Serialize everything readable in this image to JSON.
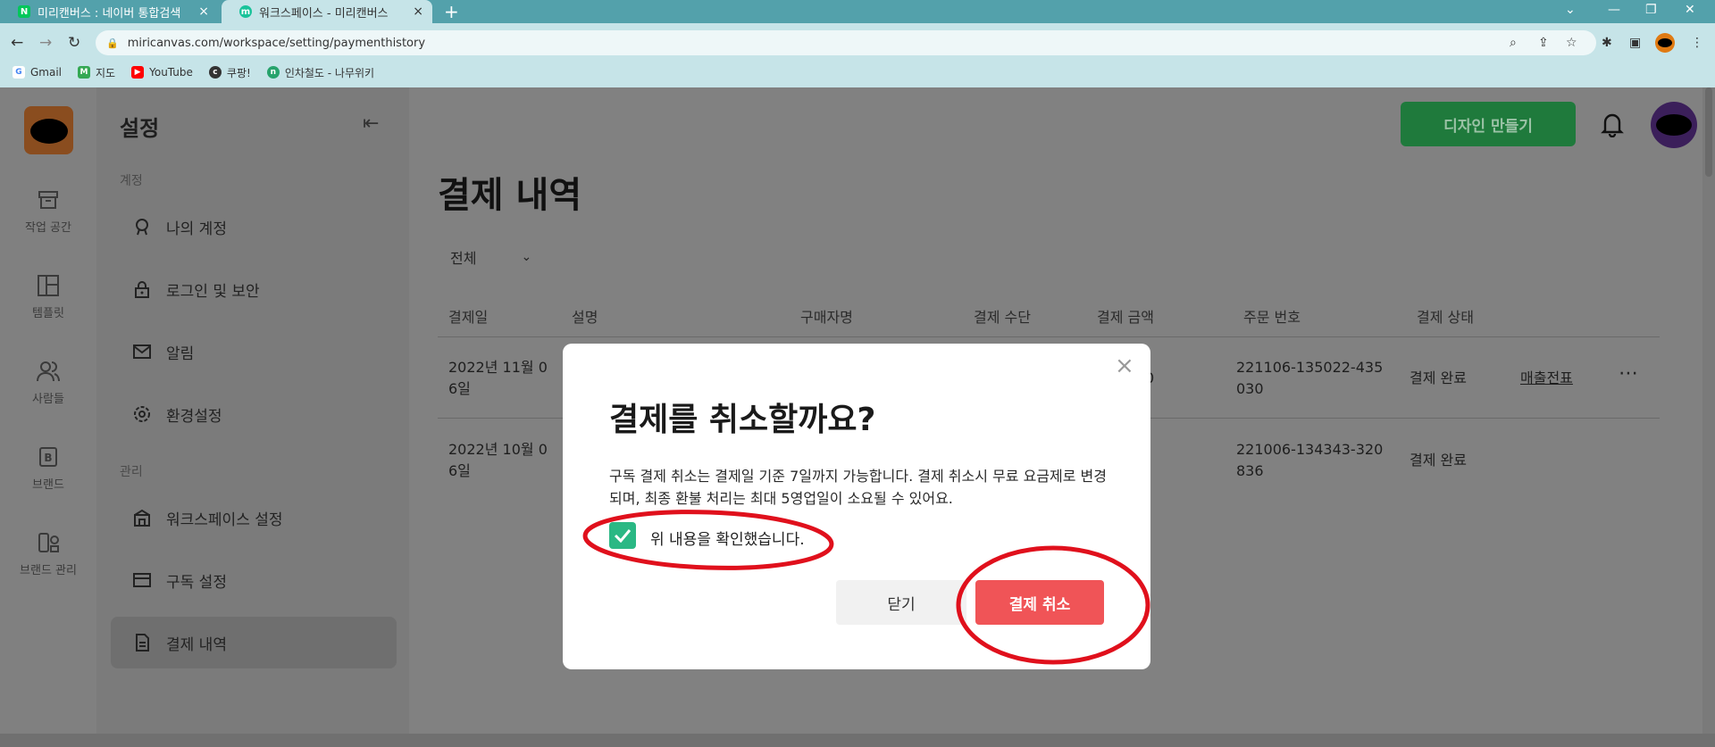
{
  "browser": {
    "tabs": [
      {
        "label": "미리캔버스 : 네이버 통합검색",
        "favicon": "N",
        "close": "×"
      },
      {
        "label": "워크스페이스 - 미리캔버스",
        "favicon": "m",
        "close": "×"
      }
    ],
    "new_tab": "+",
    "url": "miricanvas.com/workspace/setting/paymenthistory",
    "bookmarks": [
      {
        "label": "Gmail",
        "icon": "G"
      },
      {
        "label": "지도",
        "icon": "M"
      },
      {
        "label": "YouTube",
        "icon": "▶"
      },
      {
        "label": "쿠팡!",
        "icon": "c"
      },
      {
        "label": "인차철도 - 나무위키",
        "icon": "n"
      }
    ]
  },
  "app": {
    "rail": [
      {
        "label": "작업 공간",
        "icon": "archive-icon"
      },
      {
        "label": "템플릿",
        "icon": "layout-icon"
      },
      {
        "label": "사람들",
        "icon": "people-icon"
      },
      {
        "label": "브랜드",
        "icon": "brand-icon"
      },
      {
        "label": "브랜드 관리",
        "icon": "brand-manage-icon"
      }
    ],
    "sidebar": {
      "title": "설정",
      "section_account": "계정",
      "section_manage": "관리",
      "items": [
        {
          "label": "나의 계정",
          "icon": "account-icon"
        },
        {
          "label": "로그인 및 보안",
          "icon": "lock-icon"
        },
        {
          "label": "알림",
          "icon": "mail-icon"
        },
        {
          "label": "환경설정",
          "icon": "gear-icon"
        },
        {
          "label": "워크스페이스 설정",
          "icon": "building-icon"
        },
        {
          "label": "구독 설정",
          "icon": "card-icon"
        },
        {
          "label": "결제 내역",
          "icon": "document-icon"
        }
      ]
    },
    "header": {
      "create_button": "디자인 만들기"
    },
    "page_title": "결제 내역",
    "filter": "전체",
    "table": {
      "headers": [
        "결제일",
        "설명",
        "구매자명",
        "결제 수단",
        "결제 금액",
        "주문 번호",
        "결제 상태"
      ],
      "rows": [
        {
          "date_line1": "2022년 11월 0",
          "date_line2": "6일",
          "amount_fragment": "0",
          "order_line1": "221106-135022-435",
          "order_line2": "030",
          "status": "결제 완료",
          "receipt": "매출전표",
          "more": "⋯"
        },
        {
          "date_line1": "2022년 10월 0",
          "date_line2": "6일",
          "order_line1": "221006-134343-320",
          "order_line2": "836",
          "status": "결제 완료"
        }
      ]
    }
  },
  "modal": {
    "title": "결제를 취소할까요?",
    "body": "구독 결제 취소는 결제일 기준 7일까지 가능합니다. 결제 취소시 무료 요금제로 변경되며, 최종 환불 처리는 최대 5영업일이 소요될 수 있어요.",
    "checkbox_label": "위 내용을 확인했습니다.",
    "checkbox_checked": true,
    "close_button": "닫기",
    "cancel_button": "결제 취소",
    "close_icon": "×"
  },
  "colors": {
    "accent_green": "#2ab884",
    "cancel_red": "#f05457",
    "annotation_red": "#e0101c",
    "tab_strip": "#53a1ab"
  }
}
